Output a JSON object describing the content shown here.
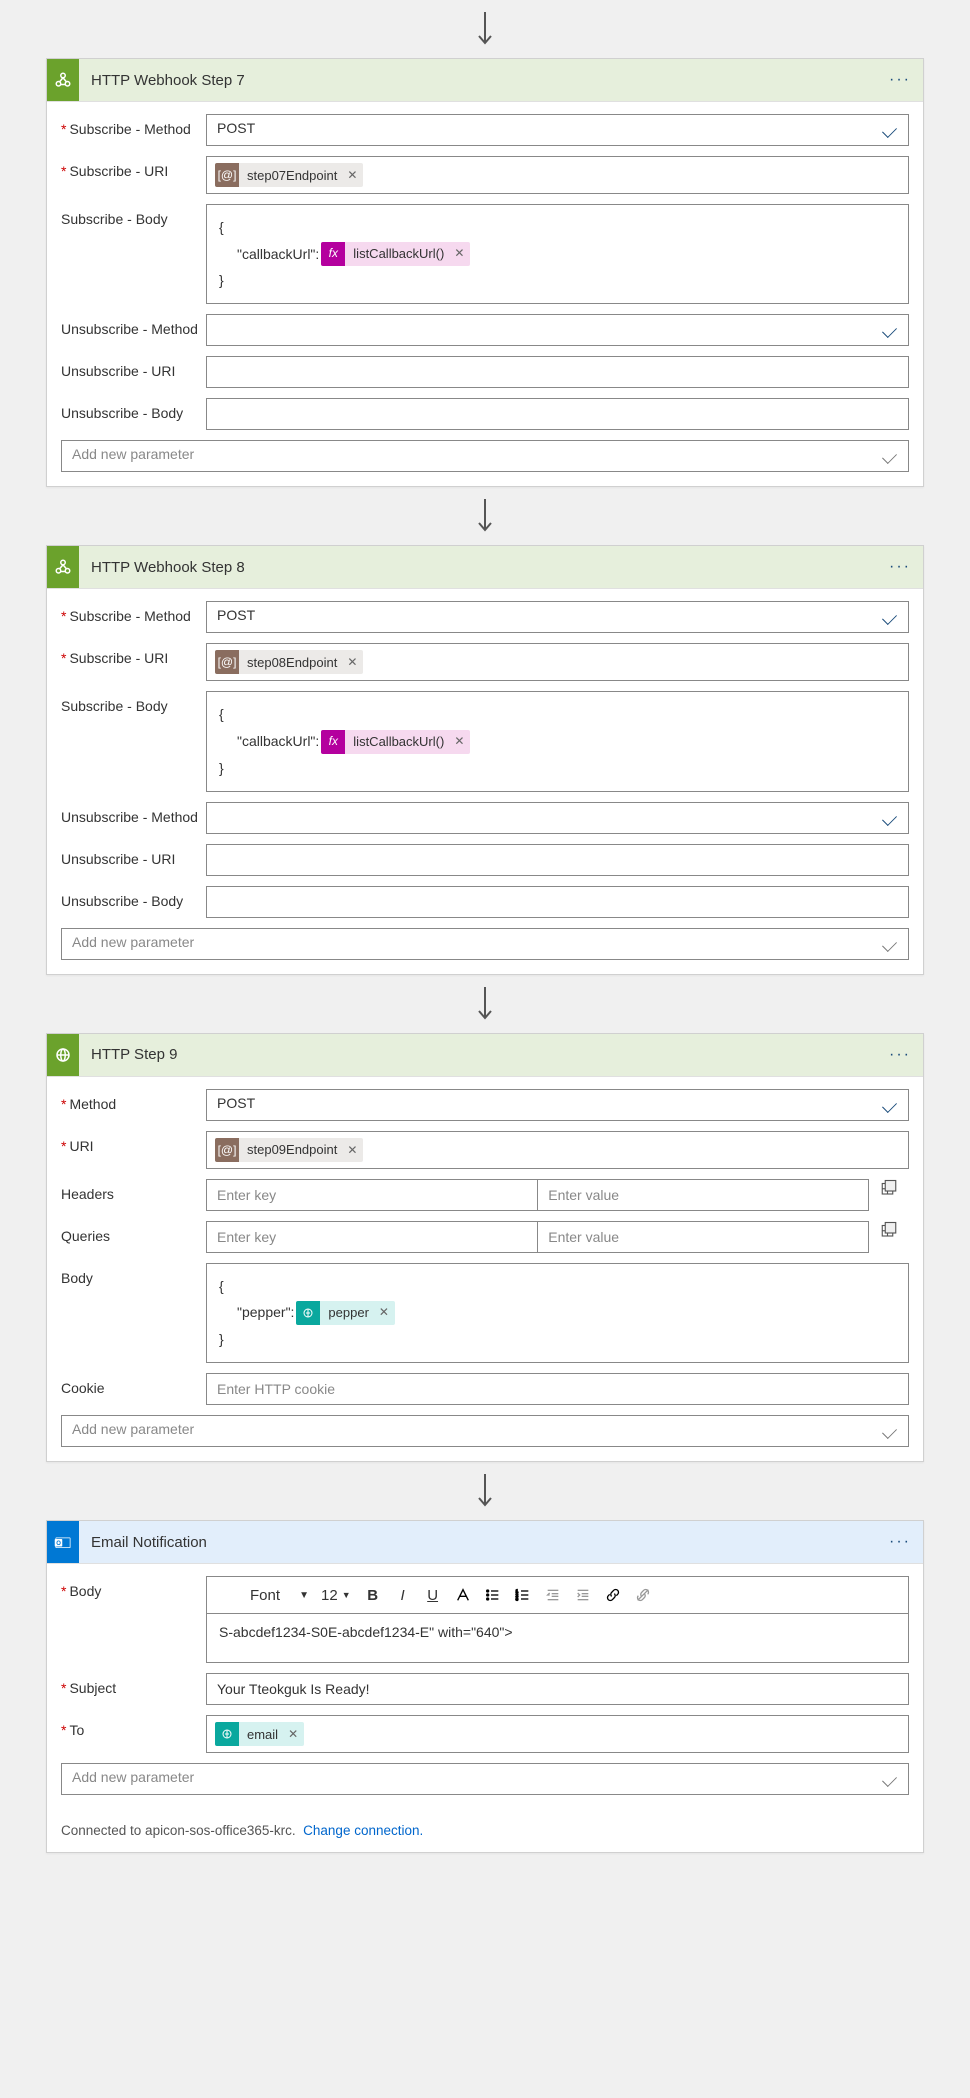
{
  "arrow": "down",
  "common": {
    "addParamPlaceholder": "Add new parameter",
    "enterKey": "Enter key",
    "enterValue": "Enter value"
  },
  "step7": {
    "title": "HTTP Webhook Step 7",
    "labels": {
      "subMethod": "Subscribe - Method",
      "subUri": "Subscribe - URI",
      "subBody": "Subscribe - Body",
      "unsubMethod": "Unsubscribe - Method",
      "unsubUri": "Unsubscribe - URI",
      "unsubBody": "Unsubscribe - Body"
    },
    "values": {
      "subMethod": "POST",
      "uriToken": "step07Endpoint",
      "bodyOpen": "{",
      "bodyKey": "\"callbackUrl\":",
      "bodyFunc": "listCallbackUrl()",
      "bodyClose": "}"
    }
  },
  "step8": {
    "title": "HTTP Webhook Step 8",
    "labels": {
      "subMethod": "Subscribe - Method",
      "subUri": "Subscribe - URI",
      "subBody": "Subscribe - Body",
      "unsubMethod": "Unsubscribe - Method",
      "unsubUri": "Unsubscribe - URI",
      "unsubBody": "Unsubscribe - Body"
    },
    "values": {
      "subMethod": "POST",
      "uriToken": "step08Endpoint",
      "bodyOpen": "{",
      "bodyKey": "\"callbackUrl\":",
      "bodyFunc": "listCallbackUrl()",
      "bodyClose": "}"
    }
  },
  "step9": {
    "title": "HTTP Step 9",
    "labels": {
      "method": "Method",
      "uri": "URI",
      "headers": "Headers",
      "queries": "Queries",
      "body": "Body",
      "cookie": "Cookie"
    },
    "values": {
      "method": "POST",
      "uriToken": "step09Endpoint",
      "bodyOpen": "{",
      "bodyKey": "\"pepper\":",
      "bodyToken": "pepper",
      "bodyClose": "}",
      "cookiePlaceholder": "Enter HTTP cookie"
    }
  },
  "email": {
    "title": "Email Notification",
    "labels": {
      "body": "Body",
      "subject": "Subject",
      "to": "To"
    },
    "toolbar": {
      "font": "Font",
      "size": "12"
    },
    "values": {
      "bodyText": "S-abcdef1234-S0E-abcdef1234-E\" with=\"640\">",
      "subject": "Your Tteokguk Is Ready!",
      "toToken": "email"
    },
    "footer": {
      "text": "Connected to apicon-sos-office365-krc.",
      "link": "Change connection."
    }
  }
}
